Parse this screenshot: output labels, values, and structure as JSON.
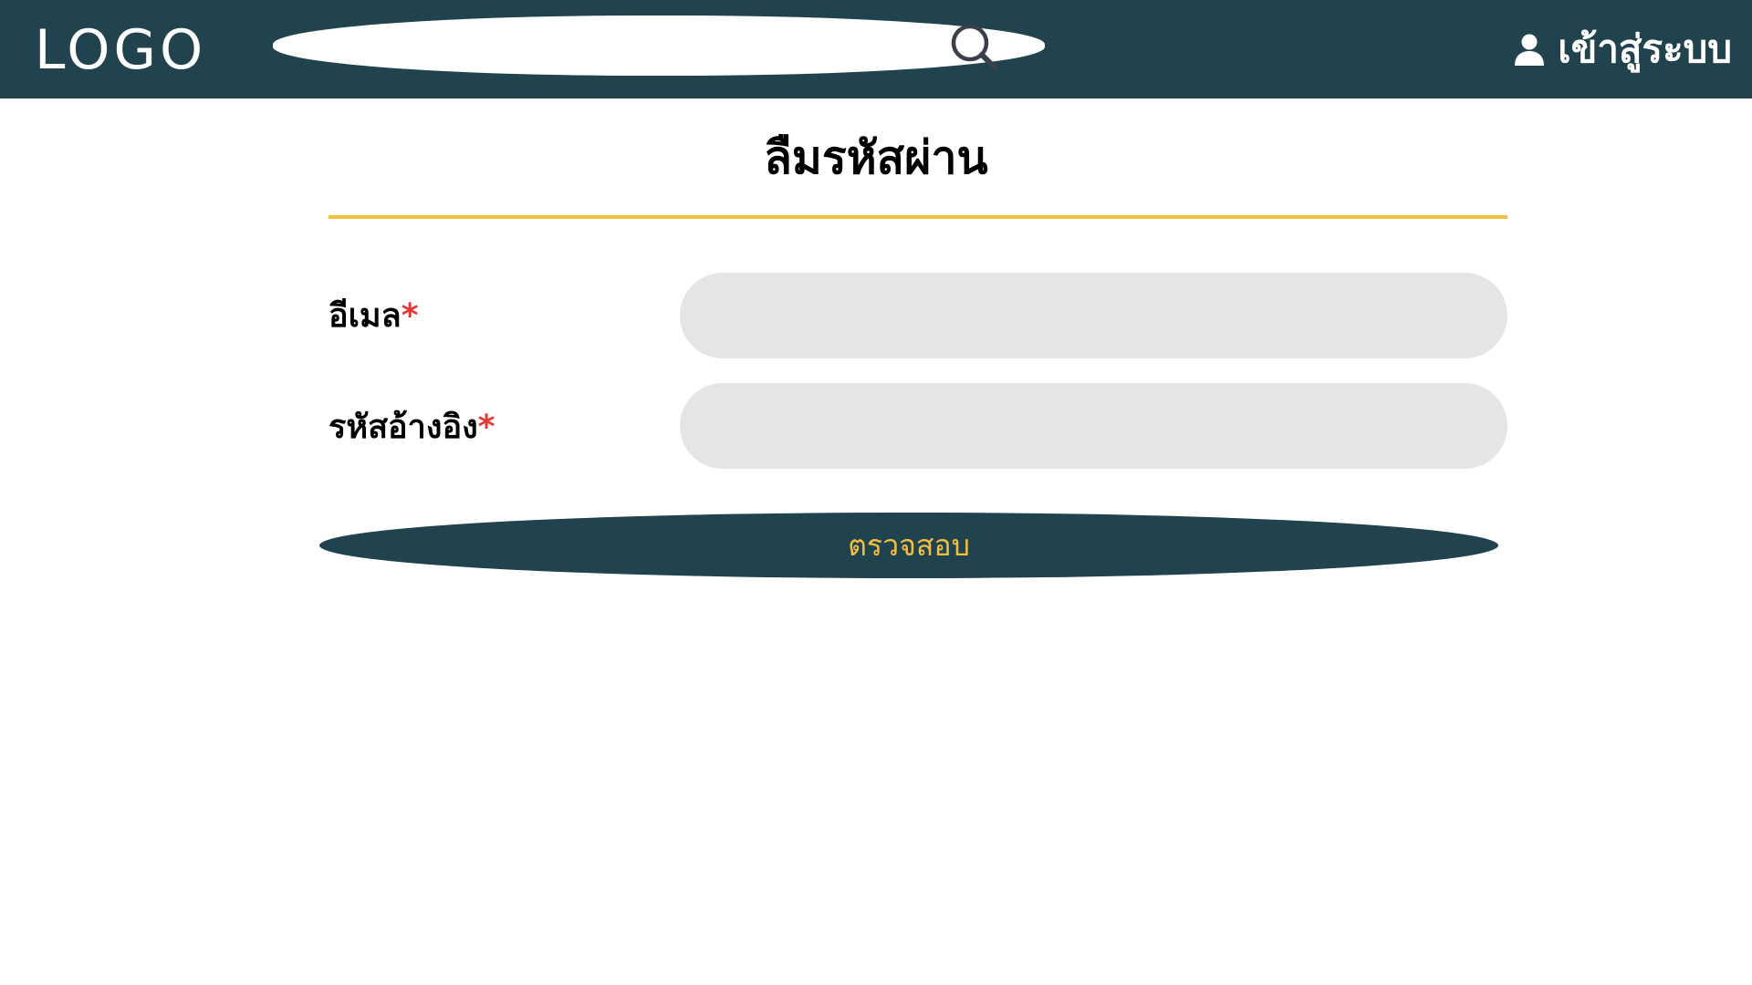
{
  "header": {
    "logo": "LOGO",
    "search": {
      "value": "",
      "placeholder": "",
      "icon": "search-icon"
    },
    "login": {
      "label": "เข้าสู่ระบบ",
      "icon": "user-icon"
    }
  },
  "main": {
    "title": "ลืมรหัสผ่าน",
    "fields": [
      {
        "label": "อีเมล",
        "required_mark": "*",
        "value": "",
        "placeholder": ""
      },
      {
        "label": "รหัสอ้างอิง",
        "required_mark": "*",
        "value": "",
        "placeholder": ""
      }
    ],
    "submit_label": "ตรวจสอบ"
  },
  "colors": {
    "header_bg": "#21434e",
    "accent": "#f2bf3f",
    "required": "#e53935",
    "field_bg": "#e6e5e3"
  }
}
